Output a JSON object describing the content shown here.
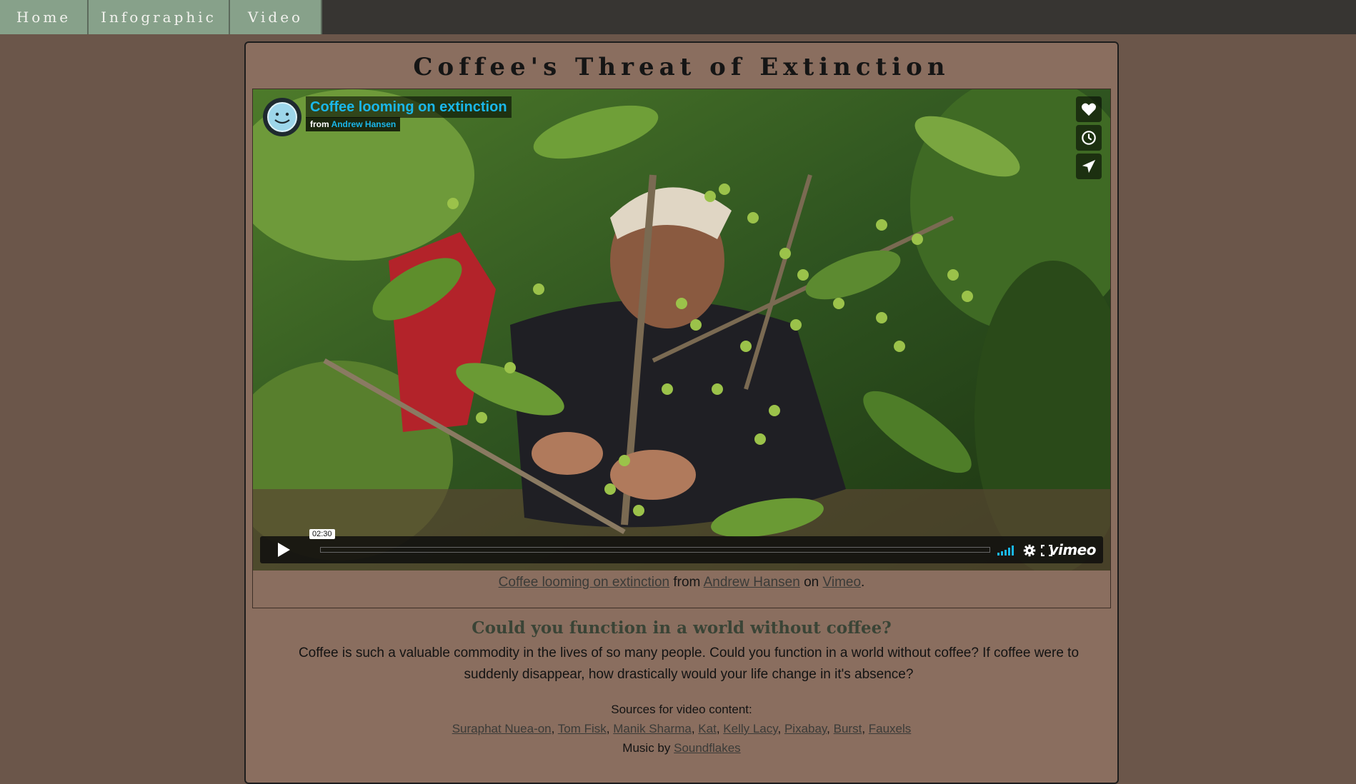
{
  "nav": {
    "tabs": [
      {
        "label": "Home"
      },
      {
        "label": "Infographic"
      },
      {
        "label": "Video"
      }
    ]
  },
  "page": {
    "title": "Coffee's Threat of Extinction"
  },
  "video": {
    "title": "Coffee looming on extinction",
    "from_label": "from",
    "author": "Andrew Hansen",
    "timecode": "02:30",
    "player_logo": "vimeo",
    "icons": [
      "like-icon",
      "watch-later-icon",
      "share-icon",
      "play-icon",
      "volume-icon",
      "settings-icon",
      "fullscreen-icon"
    ],
    "accent_color": "#1ab7ea"
  },
  "caption": {
    "video_link": "Coffee looming on extinction",
    "from_text": "from",
    "author_link": "Andrew Hansen",
    "on_text": "on",
    "platform_link": "Vimeo",
    "end": "."
  },
  "article": {
    "question": "Could you function in a world without coffee?",
    "paragraph": "Coffee is such a valuable commodity in the lives of so many people. Could you function in a world without coffee? If coffee were to suddenly disappear, how drastically would your life change in it's absence?"
  },
  "sources": {
    "label": "Sources for video content:",
    "links": [
      "Suraphat Nuea-on",
      "Tom Fisk",
      "Manik Sharma",
      "Kat",
      "Kelly Lacy",
      "Pixabay",
      "Burst",
      "Fauxels"
    ],
    "separator": ", ",
    "music_label": "Music by",
    "music_link": "Soundflakes"
  }
}
